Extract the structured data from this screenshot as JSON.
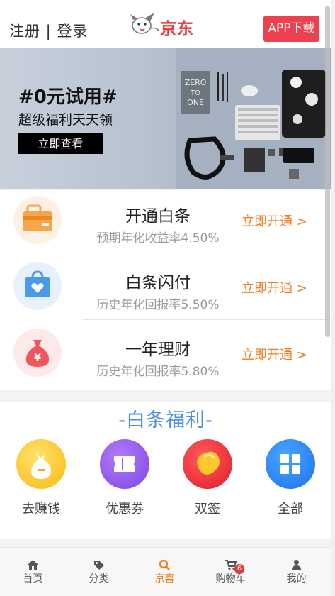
{
  "header": {
    "register": "注册",
    "separator": " | ",
    "login": "登录",
    "logo_text": "京东",
    "app_download": "APP下载"
  },
  "banner": {
    "title": "#0元试用#",
    "subtitle": "超级福利天天领",
    "button": "立即查看"
  },
  "finance": [
    {
      "title": "开通白条",
      "subtitle": "预期年化收益率4.50%",
      "action": "立即开通 >",
      "icon": "wallet-card-icon",
      "icon_bg": "#fdf1e6"
    },
    {
      "title": "白条闪付",
      "subtitle": "历史年化回报率5.50%",
      "action": "立即开通 >",
      "icon": "heart-bag-icon",
      "icon_bg": "#e7f1fb"
    },
    {
      "title": "一年理财",
      "subtitle": "历史年化回报率5.80%",
      "action": "立即开通 >",
      "icon": "money-bag-icon",
      "icon_bg": "#fde9ea"
    }
  ],
  "welfare": {
    "title": "-白条福利-",
    "items": [
      {
        "label": "去赚钱",
        "icon": "coin-bag-icon"
      },
      {
        "label": "优惠券",
        "icon": "ticket-icon"
      },
      {
        "label": "双签",
        "icon": "bean-icon"
      },
      {
        "label": "全部",
        "icon": "grid-icon"
      }
    ]
  },
  "tabbar": [
    {
      "label": "首页",
      "icon": "home-icon",
      "active": false
    },
    {
      "label": "分类",
      "icon": "tag-icon",
      "active": false
    },
    {
      "label": "京喜",
      "icon": "search-icon",
      "active": true
    },
    {
      "label": "购物车",
      "icon": "cart-icon",
      "active": false,
      "badge": "6"
    },
    {
      "label": "我的",
      "icon": "user-icon",
      "active": false
    }
  ],
  "colors": {
    "brand_red": "#e4393c",
    "app_button": "#ee4150",
    "accent_orange": "#f07b1e",
    "welfare_blue": "#4a8ee8"
  }
}
